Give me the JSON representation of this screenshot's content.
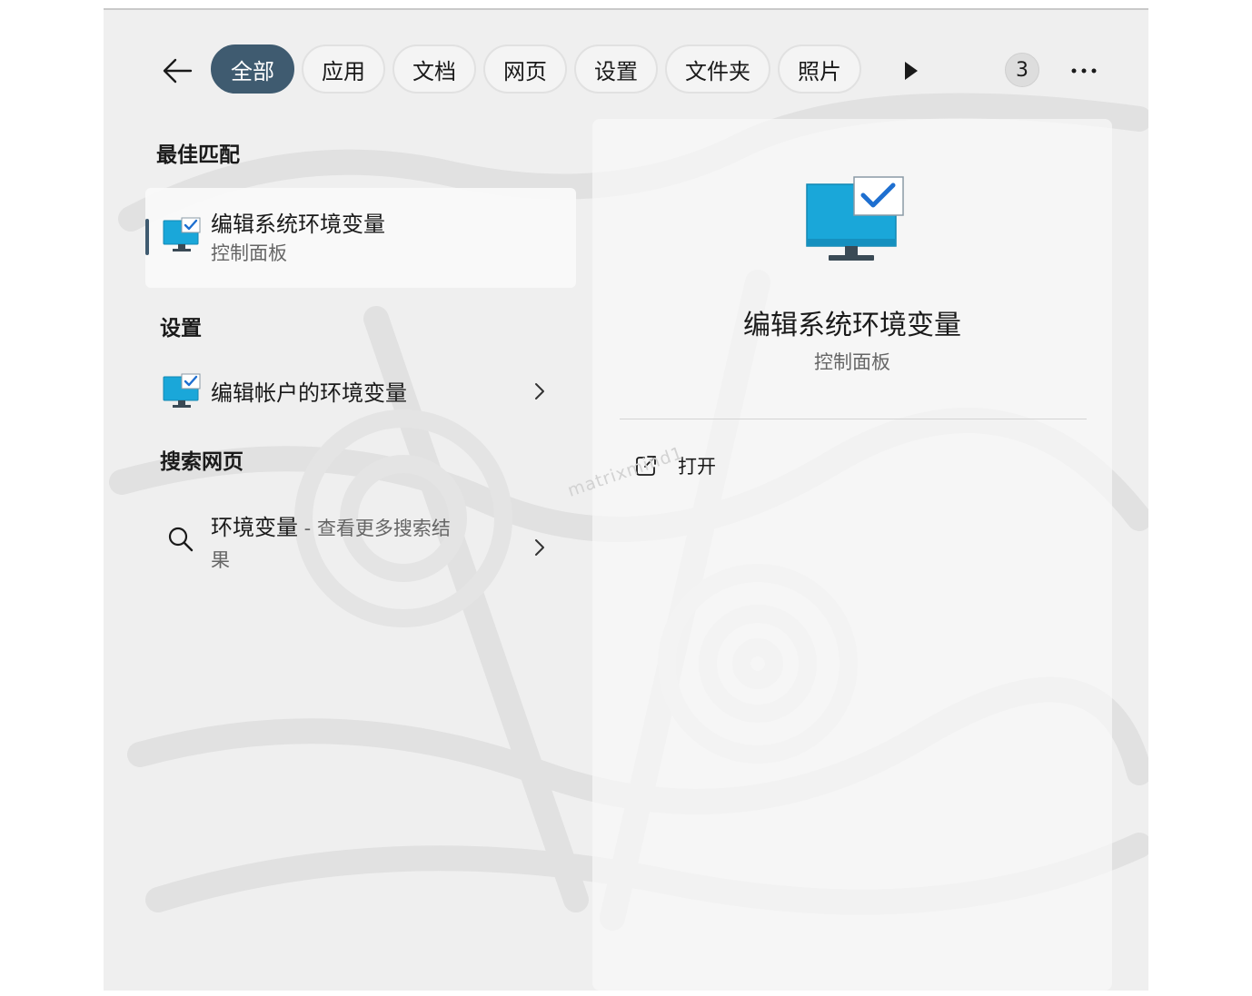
{
  "toolbar": {
    "tabs": [
      {
        "label": "全部",
        "active": true
      },
      {
        "label": "应用",
        "active": false
      },
      {
        "label": "文档",
        "active": false
      },
      {
        "label": "网页",
        "active": false
      },
      {
        "label": "设置",
        "active": false
      },
      {
        "label": "文件夹",
        "active": false
      },
      {
        "label": "照片",
        "active": false
      }
    ],
    "badge_count": "3"
  },
  "best_match": {
    "section_title": "最佳匹配",
    "title": "编辑系统环境变量",
    "subtitle": "控制面板"
  },
  "settings": {
    "section_title": "设置",
    "item_label": "编辑帐户的环境变量"
  },
  "web_search": {
    "section_title": "搜索网页",
    "query": "环境变量",
    "separator": " - ",
    "suffix_line1": "查看更多搜索结",
    "suffix_line2": "果"
  },
  "detail": {
    "title": "编辑系统环境变量",
    "subtitle": "控制面板",
    "open_label": "打开"
  },
  "watermark": "matrixmind1",
  "icons": {
    "back": "back-arrow-icon",
    "more_tabs": "play-triangle-icon",
    "menu": "more-dots-icon",
    "app": "monitor-check-icon",
    "search": "search-icon",
    "chevron": "chevron-right-icon",
    "open": "open-external-icon"
  },
  "colors": {
    "accent": "#3f5b70",
    "monitor_screen": "#1aa7d9",
    "check": "#1e6fd0"
  }
}
